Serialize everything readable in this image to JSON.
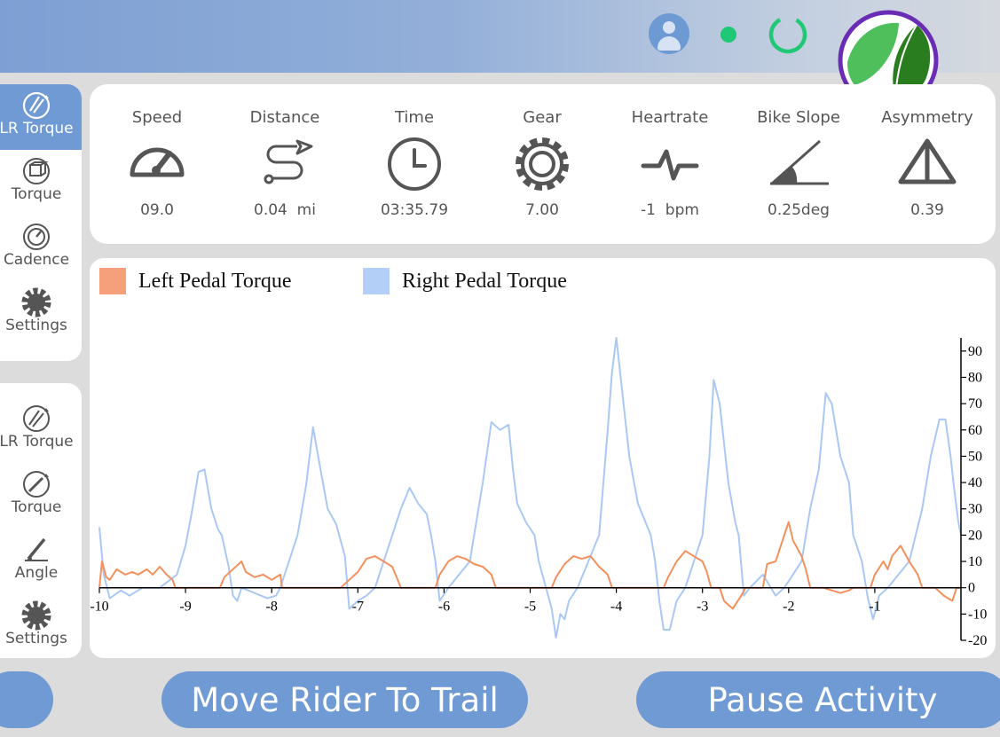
{
  "sidebar": {
    "group1": [
      {
        "label": "LR Torque",
        "icon": "lr-torque-icon",
        "active": true
      },
      {
        "label": "Torque",
        "icon": "torque-icon",
        "active": false
      },
      {
        "label": "Cadence",
        "icon": "cadence-icon",
        "active": false
      },
      {
        "label": "Settings",
        "icon": "gear-icon",
        "active": false
      }
    ],
    "group2": [
      {
        "label": "LR Torque",
        "icon": "lr-torque-icon"
      },
      {
        "label": "Torque",
        "icon": "torque-icon"
      },
      {
        "label": "Angle",
        "icon": "angle-icon"
      },
      {
        "label": "Settings",
        "icon": "gear-icon"
      }
    ]
  },
  "metrics": [
    {
      "label": "Speed",
      "value": "09.0",
      "icon": "speedometer-icon"
    },
    {
      "label": "Distance",
      "value": "0.04  mi",
      "icon": "route-icon"
    },
    {
      "label": "Time",
      "value": "03:35.79",
      "icon": "clock-icon"
    },
    {
      "label": "Gear",
      "value": "7.00",
      "icon": "gear-icon"
    },
    {
      "label": "Heartrate",
      "value": "-1  bpm",
      "icon": "heartbeat-icon"
    },
    {
      "label": "Bike Slope",
      "value": "0.25deg",
      "icon": "slope-icon"
    },
    {
      "label": "Asymmetry",
      "value": "0.39",
      "icon": "asymmetry-icon"
    }
  ],
  "buttons": {
    "move_rider": "Move Rider To Trail",
    "pause": "Pause Activity",
    "left": ""
  },
  "colors": {
    "accent": "#6f9ad3",
    "left_series": "#f5905c",
    "right_series": "#aac8f5",
    "status": "#1fc874",
    "logo_ring": "#6a2bb5"
  },
  "chart_data": {
    "type": "line",
    "title": "",
    "xlabel": "",
    "ylabel": "",
    "xlim": [
      -10,
      0
    ],
    "ylim": [
      -20,
      95
    ],
    "legend_position": "top-left",
    "x_ticks": [
      -10,
      -9,
      -8,
      -7,
      -6,
      -5,
      -4,
      -3,
      -2,
      -1
    ],
    "y_ticks": [
      90,
      80,
      70,
      60,
      50,
      40,
      30,
      20,
      10,
      0,
      -10,
      -20
    ],
    "series": [
      {
        "name": "Left Pedal Torque",
        "color": "#f5905c",
        "points": [
          [
            -10,
            0
          ],
          [
            -9.97,
            10
          ],
          [
            -9.92,
            4
          ],
          [
            -9.88,
            3
          ],
          [
            -9.8,
            7
          ],
          [
            -9.7,
            5
          ],
          [
            -9.62,
            6
          ],
          [
            -9.55,
            5
          ],
          [
            -9.45,
            7
          ],
          [
            -9.38,
            5
          ],
          [
            -9.3,
            8
          ],
          [
            -9.22,
            5
          ],
          [
            -9.15,
            3
          ],
          [
            -9.12,
            0
          ],
          [
            -8.6,
            0
          ],
          [
            -8.55,
            4
          ],
          [
            -8.45,
            7
          ],
          [
            -8.35,
            10
          ],
          [
            -8.3,
            6
          ],
          [
            -8.2,
            4
          ],
          [
            -8.1,
            5
          ],
          [
            -8.0,
            3
          ],
          [
            -7.9,
            5
          ],
          [
            -7.88,
            0
          ],
          [
            -7.2,
            0
          ],
          [
            -7.1,
            3
          ],
          [
            -7.0,
            6
          ],
          [
            -6.9,
            11
          ],
          [
            -6.8,
            12
          ],
          [
            -6.7,
            10
          ],
          [
            -6.6,
            8
          ],
          [
            -6.55,
            4
          ],
          [
            -6.5,
            0
          ],
          [
            -6.1,
            0
          ],
          [
            -6.05,
            5
          ],
          [
            -5.95,
            10
          ],
          [
            -5.85,
            12
          ],
          [
            -5.75,
            11
          ],
          [
            -5.65,
            9
          ],
          [
            -5.55,
            8
          ],
          [
            -5.45,
            5
          ],
          [
            -5.4,
            0
          ],
          [
            -4.75,
            0
          ],
          [
            -4.7,
            4
          ],
          [
            -4.6,
            9
          ],
          [
            -4.5,
            12
          ],
          [
            -4.4,
            11
          ],
          [
            -4.3,
            12
          ],
          [
            -4.2,
            8
          ],
          [
            -4.1,
            5
          ],
          [
            -4.05,
            0
          ],
          [
            -3.45,
            0
          ],
          [
            -3.4,
            4
          ],
          [
            -3.3,
            10
          ],
          [
            -3.2,
            14
          ],
          [
            -3.1,
            12
          ],
          [
            -3.0,
            10
          ],
          [
            -2.95,
            6
          ],
          [
            -2.9,
            0
          ],
          [
            -2.8,
            0
          ],
          [
            -2.75,
            -5
          ],
          [
            -2.65,
            -8
          ],
          [
            -2.55,
            -3
          ],
          [
            -2.5,
            0
          ],
          [
            -2.3,
            0
          ],
          [
            -2.25,
            9
          ],
          [
            -2.15,
            10
          ],
          [
            -2.05,
            20
          ],
          [
            -2.0,
            25
          ],
          [
            -1.95,
            18
          ],
          [
            -1.85,
            12
          ],
          [
            -1.8,
            7
          ],
          [
            -1.75,
            0
          ],
          [
            -1.6,
            0
          ],
          [
            -1.5,
            -1
          ],
          [
            -1.4,
            -2
          ],
          [
            -1.3,
            -1
          ],
          [
            -1.25,
            0
          ],
          [
            -1.05,
            0
          ],
          [
            -1.0,
            5
          ],
          [
            -0.9,
            10
          ],
          [
            -0.85,
            7
          ],
          [
            -0.8,
            12
          ],
          [
            -0.7,
            16
          ],
          [
            -0.6,
            10
          ],
          [
            -0.5,
            5
          ],
          [
            -0.45,
            0
          ],
          [
            -0.3,
            0
          ],
          [
            -0.2,
            -3
          ],
          [
            -0.1,
            -5
          ],
          [
            -0.05,
            0
          ],
          [
            0,
            0
          ]
        ]
      },
      {
        "name": "Right Pedal Torque",
        "color": "#aac8f5",
        "points": [
          [
            -10,
            23
          ],
          [
            -9.95,
            5
          ],
          [
            -9.88,
            -4
          ],
          [
            -9.75,
            -1
          ],
          [
            -9.65,
            -3
          ],
          [
            -9.55,
            -1
          ],
          [
            -9.5,
            0
          ],
          [
            -9.3,
            0
          ],
          [
            -9.1,
            5
          ],
          [
            -9.0,
            16
          ],
          [
            -8.92,
            30
          ],
          [
            -8.85,
            44
          ],
          [
            -8.78,
            45
          ],
          [
            -8.7,
            30
          ],
          [
            -8.62,
            22
          ],
          [
            -8.58,
            20
          ],
          [
            -8.5,
            8
          ],
          [
            -8.45,
            -3
          ],
          [
            -8.4,
            -5
          ],
          [
            -8.35,
            0
          ],
          [
            -8.2,
            -2
          ],
          [
            -8.05,
            -4
          ],
          [
            -7.95,
            -3
          ],
          [
            -7.9,
            0
          ],
          [
            -7.7,
            20
          ],
          [
            -7.6,
            39
          ],
          [
            -7.52,
            61
          ],
          [
            -7.45,
            48
          ],
          [
            -7.35,
            30
          ],
          [
            -7.25,
            24
          ],
          [
            -7.15,
            12
          ],
          [
            -7.1,
            -8
          ],
          [
            -7.0,
            -5
          ],
          [
            -6.9,
            -3
          ],
          [
            -6.8,
            0
          ],
          [
            -6.6,
            20
          ],
          [
            -6.5,
            30
          ],
          [
            -6.4,
            38
          ],
          [
            -6.3,
            32
          ],
          [
            -6.2,
            28
          ],
          [
            -6.15,
            20
          ],
          [
            -6.1,
            10
          ],
          [
            -6.05,
            -5
          ],
          [
            -5.95,
            0
          ],
          [
            -5.7,
            10
          ],
          [
            -5.55,
            40
          ],
          [
            -5.45,
            63
          ],
          [
            -5.35,
            60
          ],
          [
            -5.25,
            62
          ],
          [
            -5.2,
            45
          ],
          [
            -5.15,
            32
          ],
          [
            -5.05,
            25
          ],
          [
            -4.95,
            20
          ],
          [
            -4.9,
            10
          ],
          [
            -4.75,
            -8
          ],
          [
            -4.7,
            -19
          ],
          [
            -4.65,
            -10
          ],
          [
            -4.6,
            -12
          ],
          [
            -4.55,
            -5
          ],
          [
            -4.45,
            0
          ],
          [
            -4.2,
            20
          ],
          [
            -4.1,
            60
          ],
          [
            -4.05,
            82
          ],
          [
            -4.0,
            95
          ],
          [
            -3.95,
            80
          ],
          [
            -3.85,
            50
          ],
          [
            -3.75,
            32
          ],
          [
            -3.6,
            20
          ],
          [
            -3.55,
            10
          ],
          [
            -3.5,
            -5
          ],
          [
            -3.45,
            -16
          ],
          [
            -3.38,
            -16
          ],
          [
            -3.3,
            -5
          ],
          [
            -3.2,
            0
          ],
          [
            -3.0,
            20
          ],
          [
            -2.92,
            50
          ],
          [
            -2.87,
            79
          ],
          [
            -2.8,
            70
          ],
          [
            -2.7,
            40
          ],
          [
            -2.62,
            25
          ],
          [
            -2.58,
            20
          ],
          [
            -2.52,
            -3
          ],
          [
            -2.45,
            0
          ],
          [
            -2.3,
            5
          ],
          [
            -2.15,
            -3
          ],
          [
            -2.05,
            0
          ],
          [
            -1.85,
            10
          ],
          [
            -1.75,
            30
          ],
          [
            -1.65,
            45
          ],
          [
            -1.57,
            74
          ],
          [
            -1.5,
            70
          ],
          [
            -1.4,
            50
          ],
          [
            -1.3,
            40
          ],
          [
            -1.25,
            20
          ],
          [
            -1.15,
            10
          ],
          [
            -1.08,
            -4
          ],
          [
            -1.02,
            -12
          ],
          [
            -0.95,
            -3
          ],
          [
            -0.85,
            0
          ],
          [
            -0.6,
            10
          ],
          [
            -0.45,
            30
          ],
          [
            -0.35,
            50
          ],
          [
            -0.25,
            64
          ],
          [
            -0.18,
            64
          ],
          [
            -0.12,
            50
          ],
          [
            -0.08,
            38
          ],
          [
            -0.03,
            25
          ],
          [
            0,
            20
          ]
        ]
      }
    ]
  }
}
